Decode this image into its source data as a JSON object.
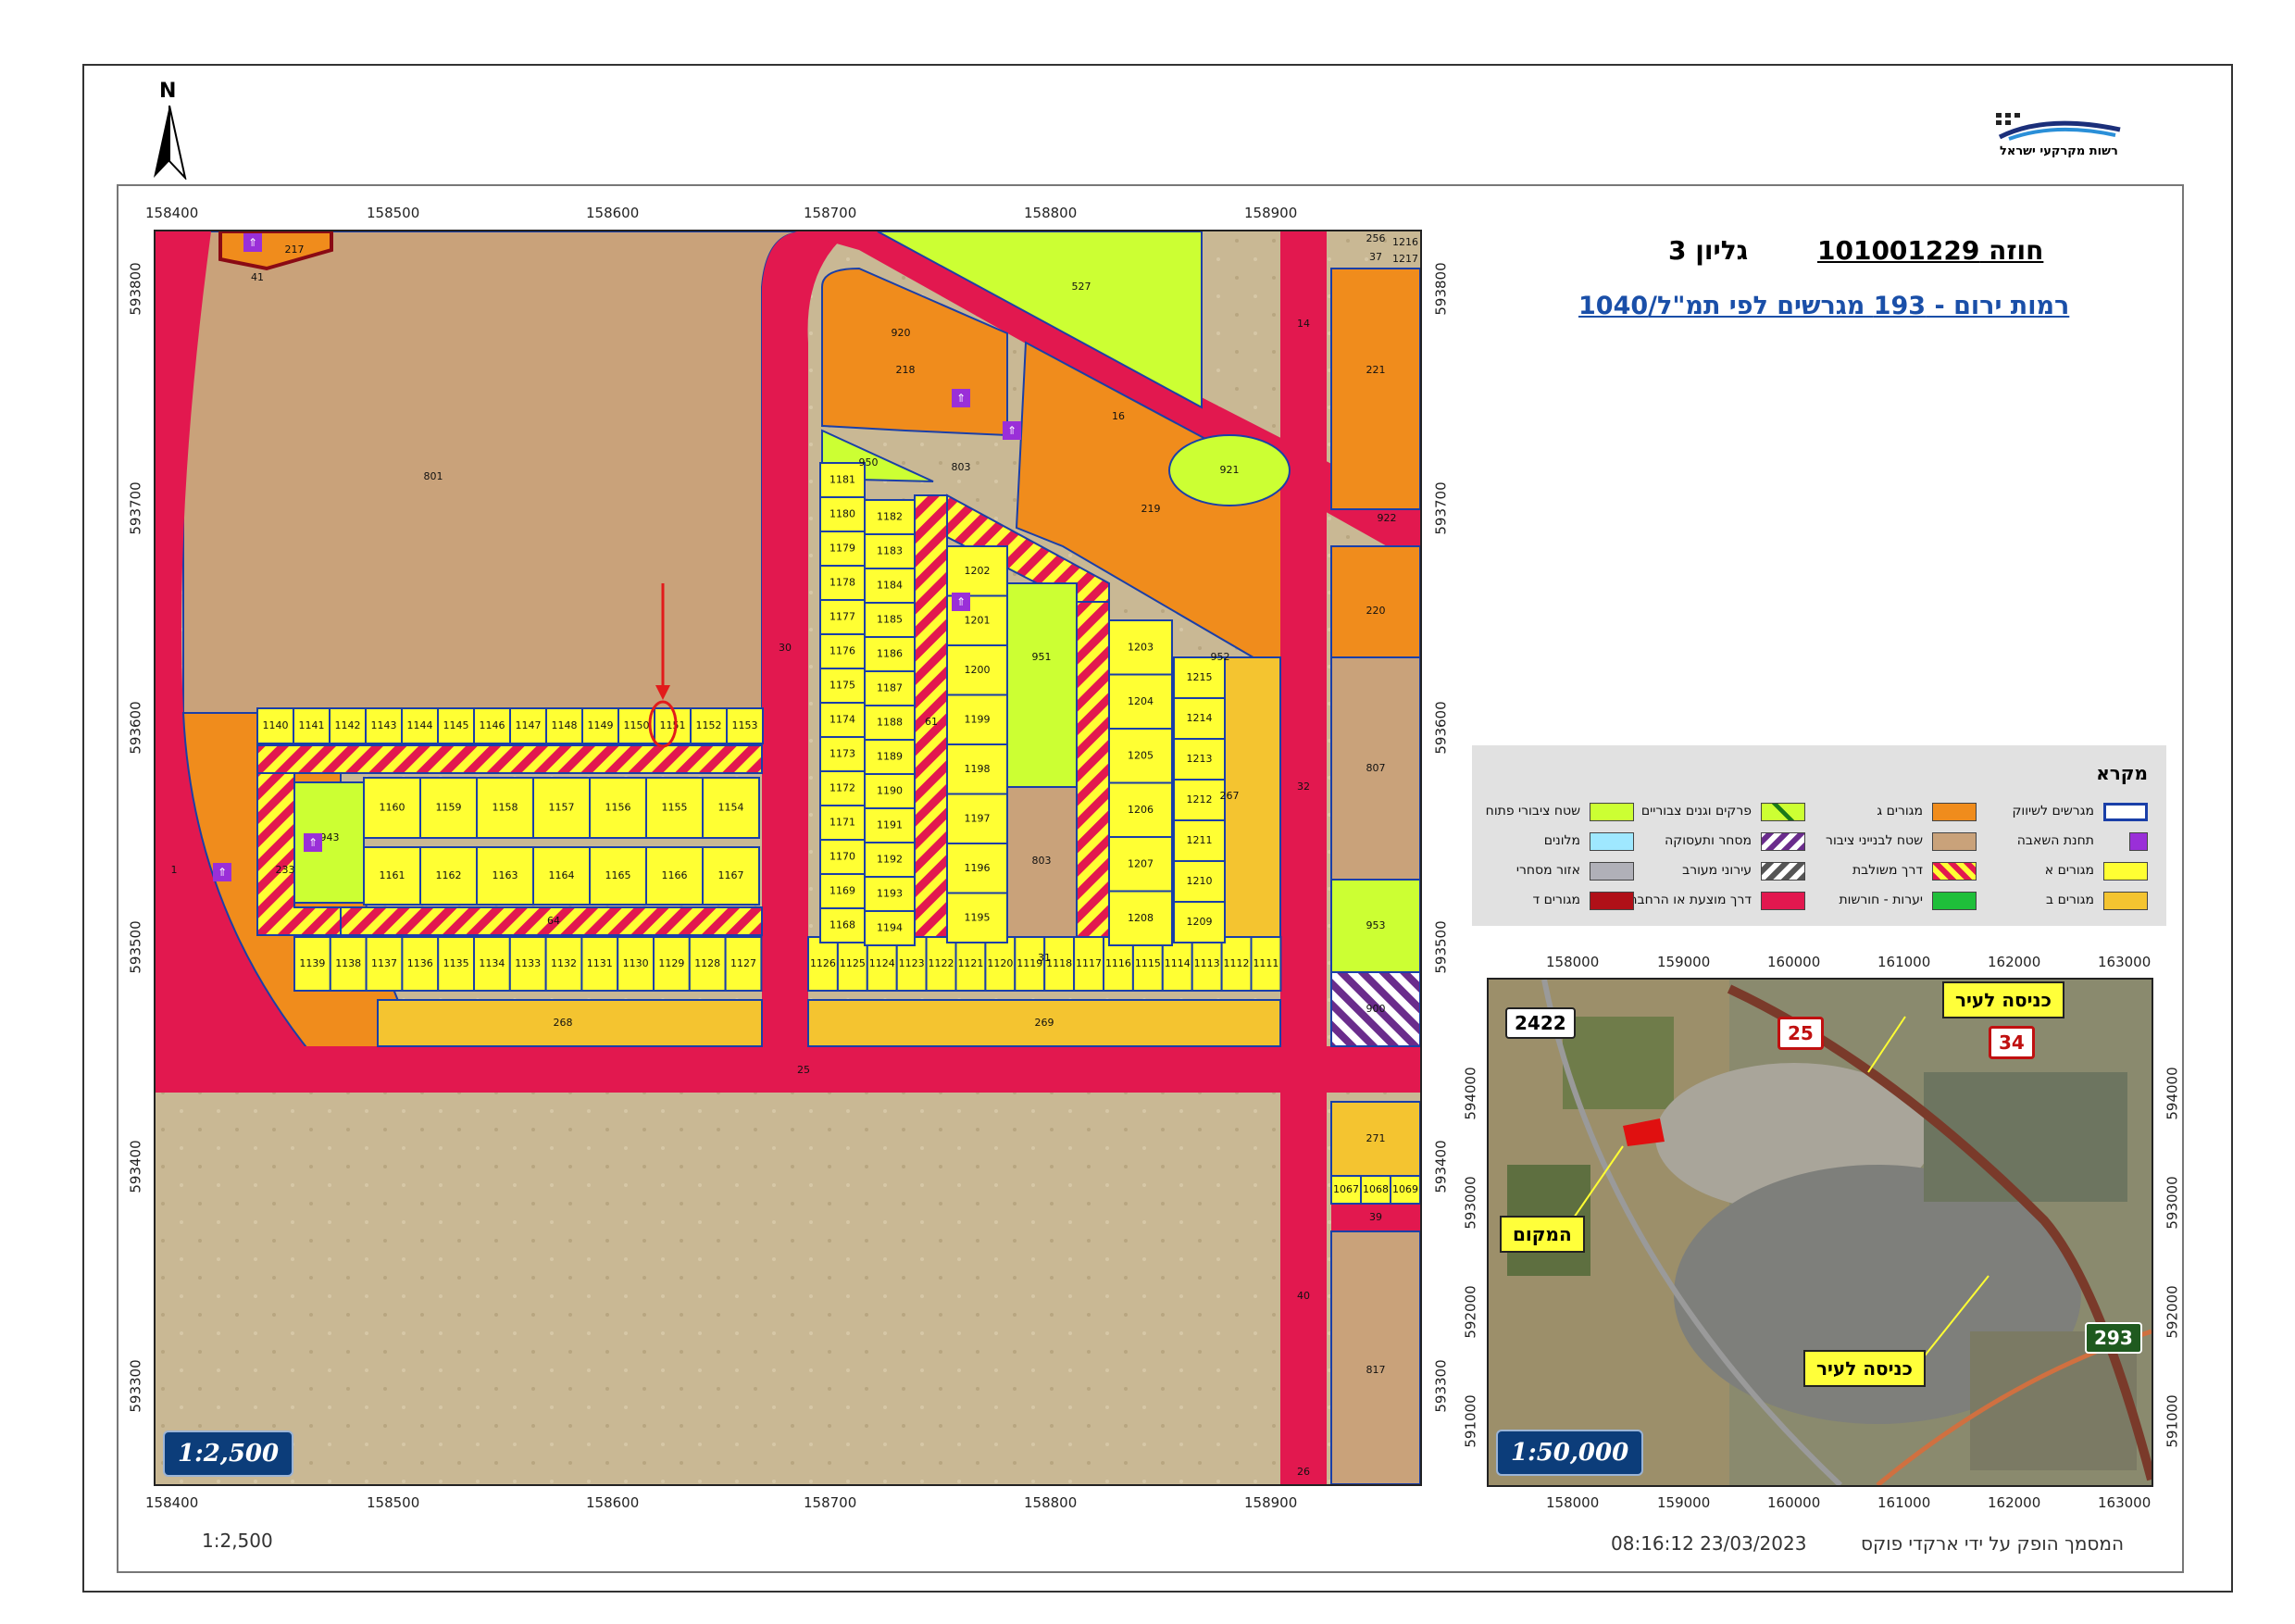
{
  "header": {
    "sheet_label": "גליון 3",
    "contract_label": "חוזה 101001229",
    "subtitle": "רמות ירום - 193 מגרשים לפי תמ\"ל/1040",
    "north_label": "N",
    "logo_text": "רשות מקרקעי ישראל"
  },
  "main_map": {
    "x_ticks": [
      "158400",
      "158500",
      "158600",
      "158700",
      "158800",
      "158900"
    ],
    "y_ticks": [
      "593800",
      "593700",
      "593600",
      "593500",
      "593400",
      "593300"
    ],
    "scale_badge": "1:2,500",
    "lots_top_row": [
      "1140",
      "1141",
      "1142",
      "1143",
      "1144",
      "1145",
      "1146",
      "1147",
      "1148",
      "1149",
      "1150",
      "1151",
      "1152",
      "1153"
    ],
    "lots_mid_row1": [
      "1160",
      "1159",
      "1158",
      "1157",
      "1156",
      "1155",
      "1154"
    ],
    "lots_mid_row2": [
      "1161",
      "1162",
      "1163",
      "1164",
      "1165",
      "1166",
      "1167"
    ],
    "lots_bottom_left": [
      "1139",
      "1138",
      "1137",
      "1136",
      "1135",
      "1134",
      "1133",
      "1132",
      "1131",
      "1130",
      "1129",
      "1128",
      "1127"
    ],
    "lots_bottom_right": [
      "1126",
      "1125",
      "1124",
      "1123",
      "1122",
      "1121",
      "1120",
      "1119",
      "1118",
      "1117",
      "1116",
      "1115",
      "1114",
      "1113",
      "1112",
      "1111"
    ],
    "lots_col_a": [
      "1181",
      "1180",
      "1179",
      "1178",
      "1177",
      "1176",
      "1175",
      "1174",
      "1173",
      "1172",
      "1171",
      "1170",
      "1169",
      "1168"
    ],
    "lots_col_b": [
      "1182",
      "1183",
      "1184",
      "1185",
      "1186",
      "1187",
      "1188",
      "1189",
      "1190",
      "1191",
      "1192",
      "1193",
      "1194"
    ],
    "lots_col_c": [
      "1202",
      "1201",
      "1200",
      "1199",
      "1198",
      "1197",
      "1196",
      "1195"
    ],
    "lots_col_d": [
      "1203",
      "1204",
      "1205",
      "1206",
      "1207",
      "1208"
    ],
    "lots_col_e": [
      "1215",
      "1214",
      "1213",
      "1212",
      "1211",
      "1210",
      "1209"
    ],
    "lots_east": [
      "1067",
      "1068",
      "1069"
    ],
    "parcel_labels": {
      "p801": "801",
      "p233": "233",
      "p268": "268",
      "p269": "269",
      "p267": "267",
      "p218": "218",
      "p219": "219",
      "p220": "220",
      "p221": "221",
      "p807": "807",
      "p817": "817",
      "p271": "271",
      "p953": "953",
      "p951": "951",
      "p803": "803",
      "p527": "527",
      "p920": "920",
      "p921": "921",
      "p922": "922",
      "p950": "950",
      "p952": "952",
      "p803b": "803",
      "p217": "217",
      "p943": "943",
      "p900": "900",
      "p1216": "1216",
      "p1217": "1217",
      "p256": "256",
      "p37": "37"
    },
    "road_labels": {
      "r25": "25",
      "r30": "30",
      "r31": "31",
      "r32": "32",
      "r64": "64",
      "r1": "1",
      "r14": "14",
      "r16": "16",
      "r41": "41",
      "r39": "39",
      "r40": "40",
      "r26": "26",
      "r61": "61"
    }
  },
  "legend": {
    "title": "מקרא",
    "items": [
      {
        "label": "מגרשים לשיווק",
        "swatch": "outline-blue"
      },
      {
        "label": "מגורים ג",
        "swatch": "orange"
      },
      {
        "label": "פרקים וגנים צבוריים",
        "swatch": "green-x"
      },
      {
        "label": "שטח ציבורי פתוח",
        "swatch": "light-green"
      },
      {
        "label": "תחנת השאבה",
        "swatch": "icon"
      },
      {
        "label": "שטח לבנייני ציבור",
        "swatch": "tan"
      },
      {
        "label": "מסחר ותעסוקה",
        "swatch": "purple-stripe"
      },
      {
        "label": "מלונים",
        "swatch": "cyan"
      },
      {
        "label": "מגורים א",
        "swatch": "yellow"
      },
      {
        "label": "דרך משולבת",
        "swatch": "red-yellow-stripe"
      },
      {
        "label": "עירוני מעורב",
        "swatch": "gray-stripe"
      },
      {
        "label": "אזור מסחרי",
        "swatch": "gray"
      },
      {
        "label": "מגורים ב",
        "swatch": "light-orange"
      },
      {
        "label": "יערות - חורשות",
        "swatch": "green"
      },
      {
        "label": "דרך מוצעת או הרחבה",
        "swatch": "crimson"
      },
      {
        "label": "מגורים ד",
        "swatch": "dark-red"
      }
    ]
  },
  "inset_map": {
    "x_ticks": [
      "158000",
      "159000",
      "160000",
      "161000",
      "162000",
      "163000"
    ],
    "y_ticks": [
      "594000",
      "593000",
      "592000",
      "591000"
    ],
    "scale_badge": "1:50,000",
    "callout_entrance_top": "כניסה לעיר",
    "callout_entrance_bottom": "כניסה לעיר",
    "callout_place": "המקום",
    "shields": {
      "s2422": "2422",
      "s25": "25",
      "s34": "34",
      "s293": "293"
    }
  },
  "footer": {
    "scale_text": "1:2,500",
    "timestamp": "08:16:12 23/03/2023",
    "produced_by": "המסמך הופק על ידי ארקדי פוקס"
  },
  "colors": {
    "road": "#e2184f",
    "residential_a": "#ffff33",
    "residential_b": "#f4c430",
    "residential_c": "#f08c1c",
    "public_open": "#ccff33",
    "public_buildings": "#c9a27a",
    "lot_outline": "#1a3fa8",
    "ground": "#c9b894"
  }
}
